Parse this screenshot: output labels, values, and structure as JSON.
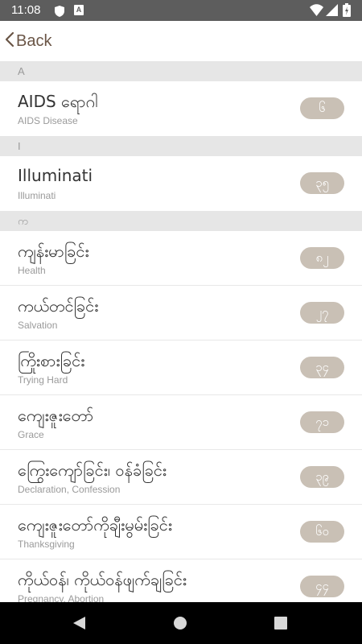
{
  "status_bar": {
    "time": "11:08",
    "icons": [
      "shield-icon",
      "a-notification-icon",
      "wifi-icon",
      "signal-icon",
      "battery-icon"
    ]
  },
  "header": {
    "back_label": "Back",
    "back_icon": "chevron-left-icon"
  },
  "sections": [
    {
      "header": "A",
      "items": [
        {
          "title": "AIDS ရောဂါ",
          "subtitle": "AIDS Disease",
          "badge": "၆"
        }
      ]
    },
    {
      "header": "I",
      "items": [
        {
          "title": "Illuminati",
          "subtitle": "Illuminati",
          "badge": "၃၅"
        }
      ]
    },
    {
      "header": "က",
      "items": [
        {
          "title": "ကျန်းမာခြင်း",
          "subtitle": "Health",
          "badge": "၈၂"
        },
        {
          "title": "ကယ်တင်ခြင်း",
          "subtitle": "Salvation",
          "badge": "၂၇"
        },
        {
          "title": "ကြိုးစားခြင်း",
          "subtitle": "Trying Hard",
          "badge": "၃၄"
        },
        {
          "title": "ကျေးဇူးတော်",
          "subtitle": "Grace",
          "badge": "၇၁"
        },
        {
          "title": "ကြွေးကျော်ခြင်း၊ ဝန်ခံခြင်း",
          "subtitle": "Declaration, Confession",
          "badge": "၃၉"
        },
        {
          "title": "ကျေးဇူးတော်ကိုချီးမွမ်းခြင်း",
          "subtitle": "Thanksgiving",
          "badge": "၆၀"
        },
        {
          "title": "ကိုယ်ဝန်၊ ကိုယ်ဝန်ဖျက်ချခြင်း",
          "subtitle": "Pregnancy, Abortion",
          "badge": "၄၄"
        }
      ]
    }
  ],
  "nav_bar": {
    "icons": [
      "nav-back-icon",
      "nav-home-icon",
      "nav-recent-icon"
    ]
  },
  "colors": {
    "status_bar": "#5d5d5d",
    "accent_brown": "#6a5546",
    "badge_bg": "#c9c0b5",
    "section_bg": "#e6e6e6"
  }
}
